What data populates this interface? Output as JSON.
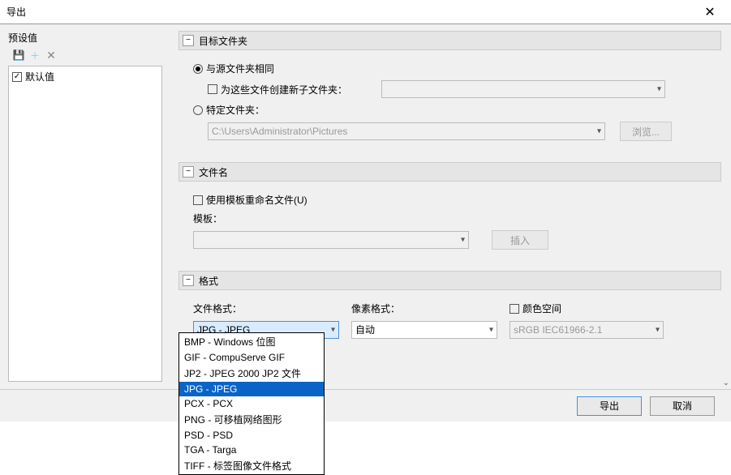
{
  "window": {
    "title": "导出",
    "close": "✕"
  },
  "sidebar": {
    "label": "预设值",
    "default_item": "默认值"
  },
  "sections": {
    "target": {
      "title": "目标文件夹",
      "same_as_source": "与源文件夹相同",
      "create_sub": "为这些文件创建新子文件夹：",
      "specific": "特定文件夹：",
      "path": "C:\\Users\\Administrator\\Pictures",
      "browse": "浏览..."
    },
    "filename": {
      "title": "文件名",
      "use_template": "使用模板重命名文件(U)",
      "template_label": "模板：",
      "insert": "插入"
    },
    "format": {
      "title": "格式",
      "file_format_label": "文件格式：",
      "file_format_value": "JPG - JPEG",
      "pixel_format_label": "像素格式：",
      "pixel_format_value": "自动",
      "colorspace_label": "颜色空间",
      "colorspace_value": "sRGB IEC61966-2.1",
      "options": [
        "BMP - Windows 位图",
        "GIF - CompuServe GIF",
        "JP2 - JPEG 2000 JP2 文件",
        "JPG - JPEG",
        "PCX - PCX",
        "PNG - 可移植网络图形",
        "PSD - PSD",
        "TGA - Targa",
        "TIFF - 标签图像文件格式"
      ]
    }
  },
  "footer": {
    "export": "导出",
    "cancel": "取消"
  }
}
